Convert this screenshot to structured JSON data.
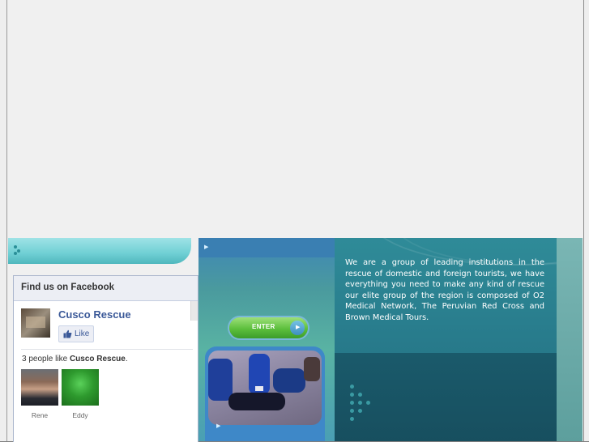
{
  "facebook": {
    "title": "Find us on Facebook",
    "page_name": "Cusco Rescue",
    "like_label": "Like",
    "people_like_prefix": "3 people like ",
    "people_like_name": "Cusco Rescue",
    "people_like_suffix": ".",
    "fans": [
      {
        "name": "Rene",
        "avatar_color": "#7a5a48"
      },
      {
        "name": "Eddy",
        "avatar_color": "#2e9a2e"
      }
    ]
  },
  "site": {
    "enter_label": "ENTER",
    "intro_text": "We are a group of leading institutions in the rescue of domestic and foreign tourists, we have everything you need to make any kind of rescue our elite group of the region is composed of O2 Medical Network, The Peruvian Red Cross and Brown Medical Tours."
  },
  "colors": {
    "facebook_blue": "#3b5998",
    "banner_teal": "#6fcfd4",
    "enter_green": "#5cbf3c",
    "panel_teal": "#236f80"
  }
}
